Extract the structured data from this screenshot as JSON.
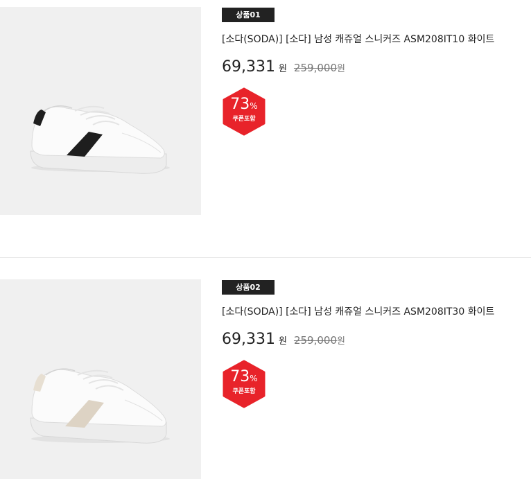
{
  "products": [
    {
      "badge": "상품01",
      "title": "[소다(SODA)] [소다] 남성 캐쥬얼 스니커즈 ASM208IT10 화이트",
      "price": "69,331",
      "price_unit": "원",
      "original_price": "259,000",
      "original_unit": "원",
      "discount_value": "73",
      "discount_symbol": "%",
      "discount_note": "쿠폰포함",
      "image_icon": "sneaker-white-black-stripe",
      "stripe_color": "#1e1e1e"
    },
    {
      "badge": "상품02",
      "title": "[소다(SODA)] [소다] 남성 캐쥬얼 스니커즈 ASM208IT30 화이트",
      "price": "69,331",
      "price_unit": "원",
      "original_price": "259,000",
      "original_unit": "원",
      "discount_value": "73",
      "discount_symbol": "%",
      "discount_note": "쿠폰포함",
      "image_icon": "sneaker-white-beige-stripe",
      "stripe_color": "#ddd3c4"
    }
  ],
  "colors": {
    "badge_bg": "#222222",
    "discount_red": "#e8232a",
    "image_bg": "#f0f0f0"
  }
}
